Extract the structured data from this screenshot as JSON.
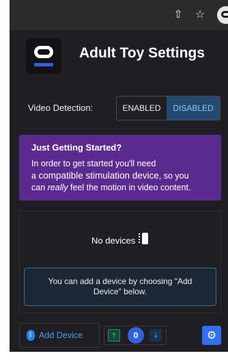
{
  "browser": {
    "share_icon": "⇧",
    "star_icon": "☆"
  },
  "header": {
    "title": "Adult Toy Settings"
  },
  "video_detection": {
    "label": "Video Detection:",
    "options": [
      "ENABLED",
      "DISABLED"
    ],
    "selected": "DISABLED"
  },
  "callout": {
    "title": "Just Getting Started?",
    "line1": "In order to get started you'll need",
    "line2_prefix": "a ",
    "link": "compatible stimulation device",
    "line2_suffix": ", so you",
    "line3_prefix": "can ",
    "emphasis": "really",
    "line3_suffix": " feel the motion in video content."
  },
  "devices": {
    "empty_label": "No devices",
    "hint": "You can add a device by choosing \"Add Device\" below."
  },
  "footer": {
    "add_device_label": "Add Device",
    "bluetooth_icon": "ᛒ",
    "up_icon": "⤒",
    "count": "0",
    "down_icon": "⤓",
    "settings_icon": "⚙"
  },
  "colors": {
    "background": "#1f1f23",
    "accent": "#2f62e0",
    "callout": "#5b2a8e",
    "selected_toggle": "#234a70"
  }
}
